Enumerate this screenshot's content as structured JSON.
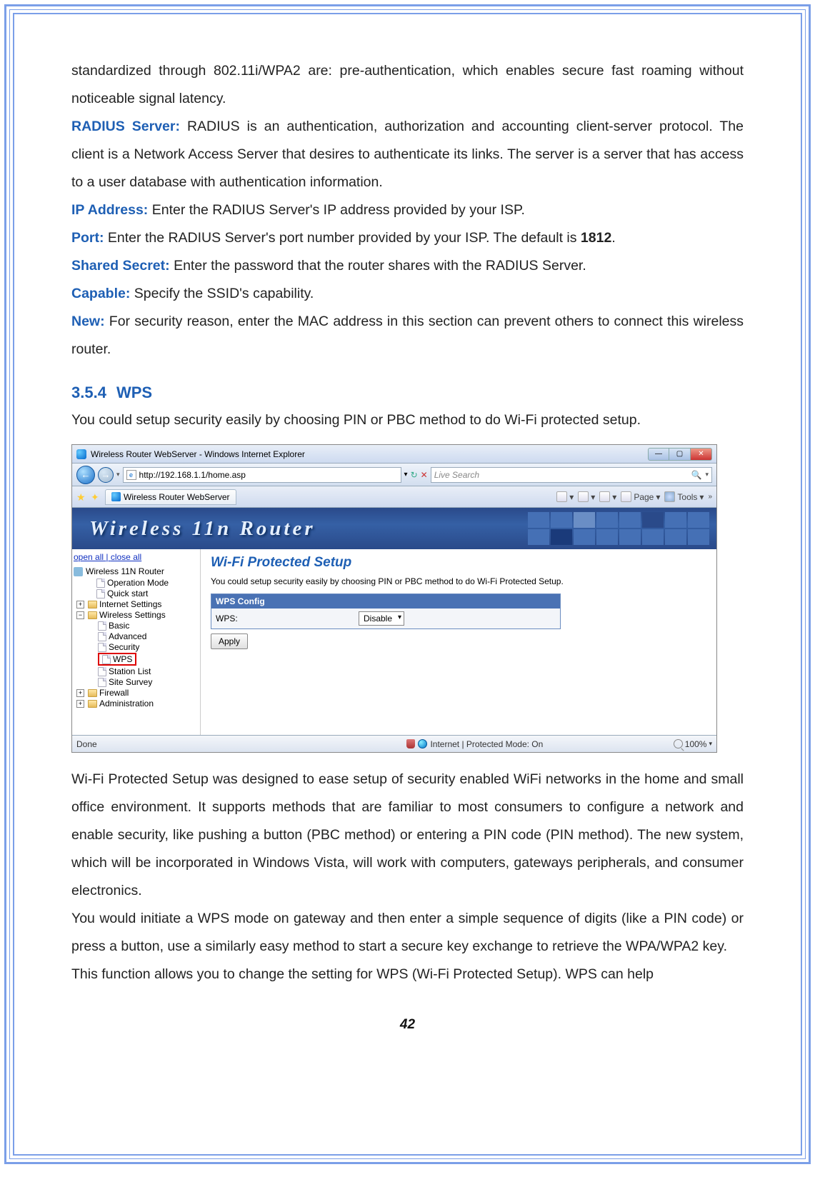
{
  "para1": "standardized through 802.11i/WPA2 are: pre-authentication, which enables secure fast roaming without noticeable signal latency.",
  "labels": {
    "radius": "RADIUS Server:",
    "ip": "IP Address:",
    "port": "Port:",
    "secret": "Shared Secret:",
    "capable": "Capable:",
    "new": "New:"
  },
  "texts": {
    "radius": " RADIUS is an authentication, authorization and accounting client-server protocol. The client is a Network Access Server that desires to authenticate its links. The server is a server that has access to a user database with authentication information.",
    "ip": " Enter the RADIUS Server's IP address provided by your ISP.",
    "port_a": " Enter the RADIUS Server's port number provided by your ISP. The default is ",
    "port_b": "1812",
    "port_c": ".",
    "secret": " Enter the password that the router shares with the RADIUS Server.",
    "capable": " Specify the SSID's capability.",
    "new": " For security reason, enter the MAC address in this section can prevent others to connect this wireless router."
  },
  "section": {
    "num": "3.5.4",
    "title": "WPS"
  },
  "intro": "You could setup security easily by choosing PIN or PBC method to do Wi-Fi protected setup.",
  "ie": {
    "title": "Wireless Router WebServer - Windows Internet Explorer",
    "url": "http://192.168.1.1/home.asp",
    "search": "Live Search",
    "tab": "Wireless Router WebServer",
    "page": "Page",
    "tools": "Tools",
    "open": "open all",
    "close": "close all",
    "status_left": "Done",
    "status_mid": "Internet | Protected Mode: On",
    "zoom": "100%"
  },
  "banner": "Wireless 11n Router",
  "tree": {
    "root": "Wireless 11N Router",
    "op": "Operation Mode",
    "qs": "Quick start",
    "inet": "Internet Settings",
    "wset": "Wireless Settings",
    "basic": "Basic",
    "adv": "Advanced",
    "sec": "Security",
    "wps": "WPS",
    "slist": "Station List",
    "survey": "Site Survey",
    "fw": "Firewall",
    "admin": "Administration"
  },
  "panel": {
    "title": "Wi-Fi Protected Setup",
    "desc": "You could setup security easily by choosing PIN or PBC method to do Wi-Fi Protected Setup.",
    "head": "WPS Config",
    "wps": "WPS:",
    "val": "Disable",
    "apply": "Apply"
  },
  "after1": "Wi-Fi Protected Setup was designed to ease setup of security enabled WiFi networks in the home and small office environment. It supports methods that are familiar to most consumers to configure a network and enable security, like pushing a button (PBC method) or entering a PIN code (PIN method). The new system, which will be incorporated in Windows Vista, will work with computers, gateways peripherals, and consumer electronics.",
  "after2": "You would initiate a WPS mode on gateway and then enter a simple sequence of digits (like a PIN code) or press a button, use a similarly easy method to start a secure key exchange to retrieve the WPA/WPA2 key.",
  "after3": "This function allows you to change the setting for WPS (Wi-Fi Protected Setup). WPS can help",
  "page": "42"
}
